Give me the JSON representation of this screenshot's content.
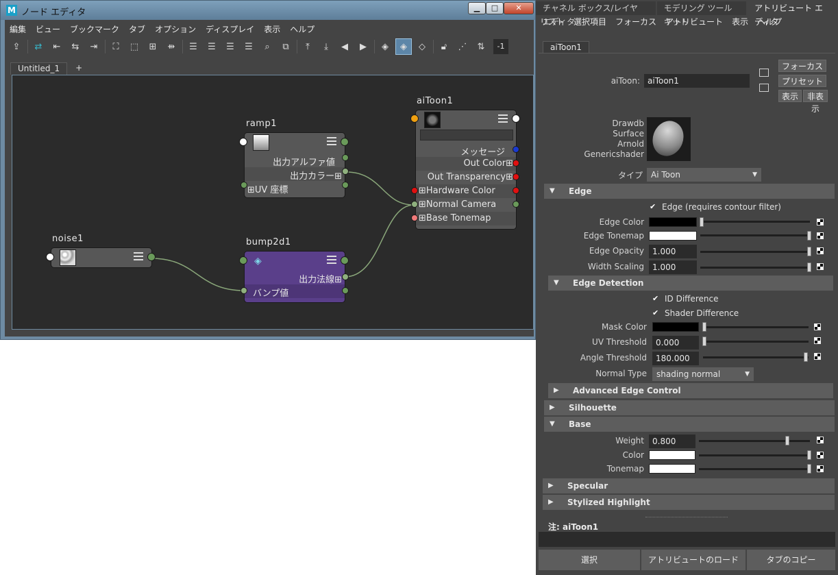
{
  "node_editor": {
    "title": "ノード エディタ",
    "window_buttons": {
      "minimize": "▁",
      "maximize": "□",
      "close": "✕"
    },
    "menu": [
      "編集",
      "ビュー",
      "ブックマーク",
      "タブ",
      "オプション",
      "ディスプレイ",
      "表示",
      "ヘルプ"
    ],
    "toolbar": {
      "negative_value": "-1"
    },
    "tabs": [
      "Untitled_1",
      "+"
    ],
    "nodes": {
      "aiToon1": {
        "title": "aiToon1",
        "attributes": [
          "メッセージ",
          "Out Color⊞",
          "Out Transparency⊞",
          "⊞Hardware Color",
          "⊞Normal Camera",
          "⊞Base Tonemap"
        ]
      },
      "ramp1": {
        "title": "ramp1",
        "attributes": [
          "出力アルファ値",
          "出力カラー⊞",
          "⊞UV 座標"
        ]
      },
      "noise1": {
        "title": "noise1"
      },
      "bump2d1": {
        "title": "bump2d1",
        "attributes": [
          "出力法線⊞",
          "バンプ値"
        ]
      }
    }
  },
  "attribute_editor": {
    "tabs": [
      "チャネル ボックス/レイヤ エディタ",
      "モデリング ツールキット",
      "アトリビュート エディタ"
    ],
    "menu": [
      "リスト",
      "選択項目",
      "フォーカス",
      "アトリビュート",
      "表示",
      "ヘルプ"
    ],
    "node_tab": "aiToon1",
    "node_label": "aiToon:",
    "node_name": "aiToon1",
    "buttons": {
      "focus": "フォーカス",
      "preset": "プリセット",
      "show": "表示",
      "hide": "非表示"
    },
    "swatch_labels": [
      "Drawdb",
      "Surface",
      "Arnold",
      "Genericshader"
    ],
    "type_label": "タイプ",
    "type_value": "Ai Toon",
    "sections": {
      "edge": {
        "title": "Edge",
        "checkbox": "Edge (requires contour filter)",
        "rows": [
          {
            "label": "Edge Color",
            "value": ""
          },
          {
            "label": "Edge Tonemap",
            "value": ""
          },
          {
            "label": "Edge Opacity",
            "value": "1.000"
          },
          {
            "label": "Width Scaling",
            "value": "1.000"
          }
        ]
      },
      "edge_detection": {
        "title": "Edge Detection",
        "checkboxes": [
          "ID Difference",
          "Shader Difference"
        ],
        "rows": [
          {
            "label": "Mask Color",
            "value": ""
          },
          {
            "label": "UV Threshold",
            "value": "0.000"
          },
          {
            "label": "Angle Threshold",
            "value": "180.000"
          }
        ],
        "normal_type_label": "Normal Type",
        "normal_type_value": "shading normal"
      },
      "advanced_edge_control": {
        "title": "Advanced Edge Control"
      },
      "silhouette": {
        "title": "Silhouette"
      },
      "base": {
        "title": "Base",
        "rows": [
          {
            "label": "Weight",
            "value": "0.800"
          },
          {
            "label": "Color",
            "value": ""
          },
          {
            "label": "Tonemap",
            "value": ""
          }
        ]
      },
      "specular": {
        "title": "Specular"
      },
      "stylized_highlight": {
        "title": "Stylized Highlight"
      }
    },
    "note_label": "注:  aiToon1",
    "bottom_buttons": [
      "選択",
      "アトリビュートのロード",
      "タブのコピー"
    ],
    "levels": {
      "edge_opacity": 1.0,
      "width_scaling": 1.0,
      "uv_threshold": 0.0,
      "angle_threshold": 1.0,
      "weight": 0.8
    }
  },
  "colors": {
    "ui_bg": "#444444",
    "graph_bg": "#2b2b2b",
    "bump_node": "#5a3f8a",
    "port_green": "#6a9a5a",
    "port_red": "#e01010",
    "port_blue": "#1a3ad0",
    "port_orange": "#f0a010"
  }
}
